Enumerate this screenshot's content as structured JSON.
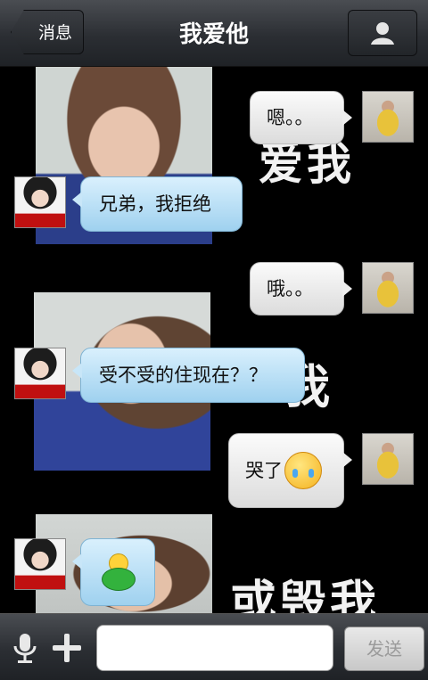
{
  "header": {
    "back_label": "消息",
    "title": "我爱他"
  },
  "background_texts": [
    "爱我",
    "我",
    "或毁我"
  ],
  "messages": [
    {
      "side": "right",
      "text": "嗯。。"
    },
    {
      "side": "left",
      "text": "兄弟，我拒绝"
    },
    {
      "side": "right",
      "text": "哦。。"
    },
    {
      "side": "left",
      "text": "受不受的住现在？？"
    },
    {
      "side": "right",
      "text": "哭了",
      "emoji": "crying-face"
    },
    {
      "side": "left",
      "sticker": "green-figure"
    }
  ],
  "input": {
    "value": "",
    "send_label": "发送"
  },
  "icons": {
    "back": "back-arrow",
    "profile": "person-icon",
    "voice": "microphone-icon",
    "more": "plus-icon"
  }
}
